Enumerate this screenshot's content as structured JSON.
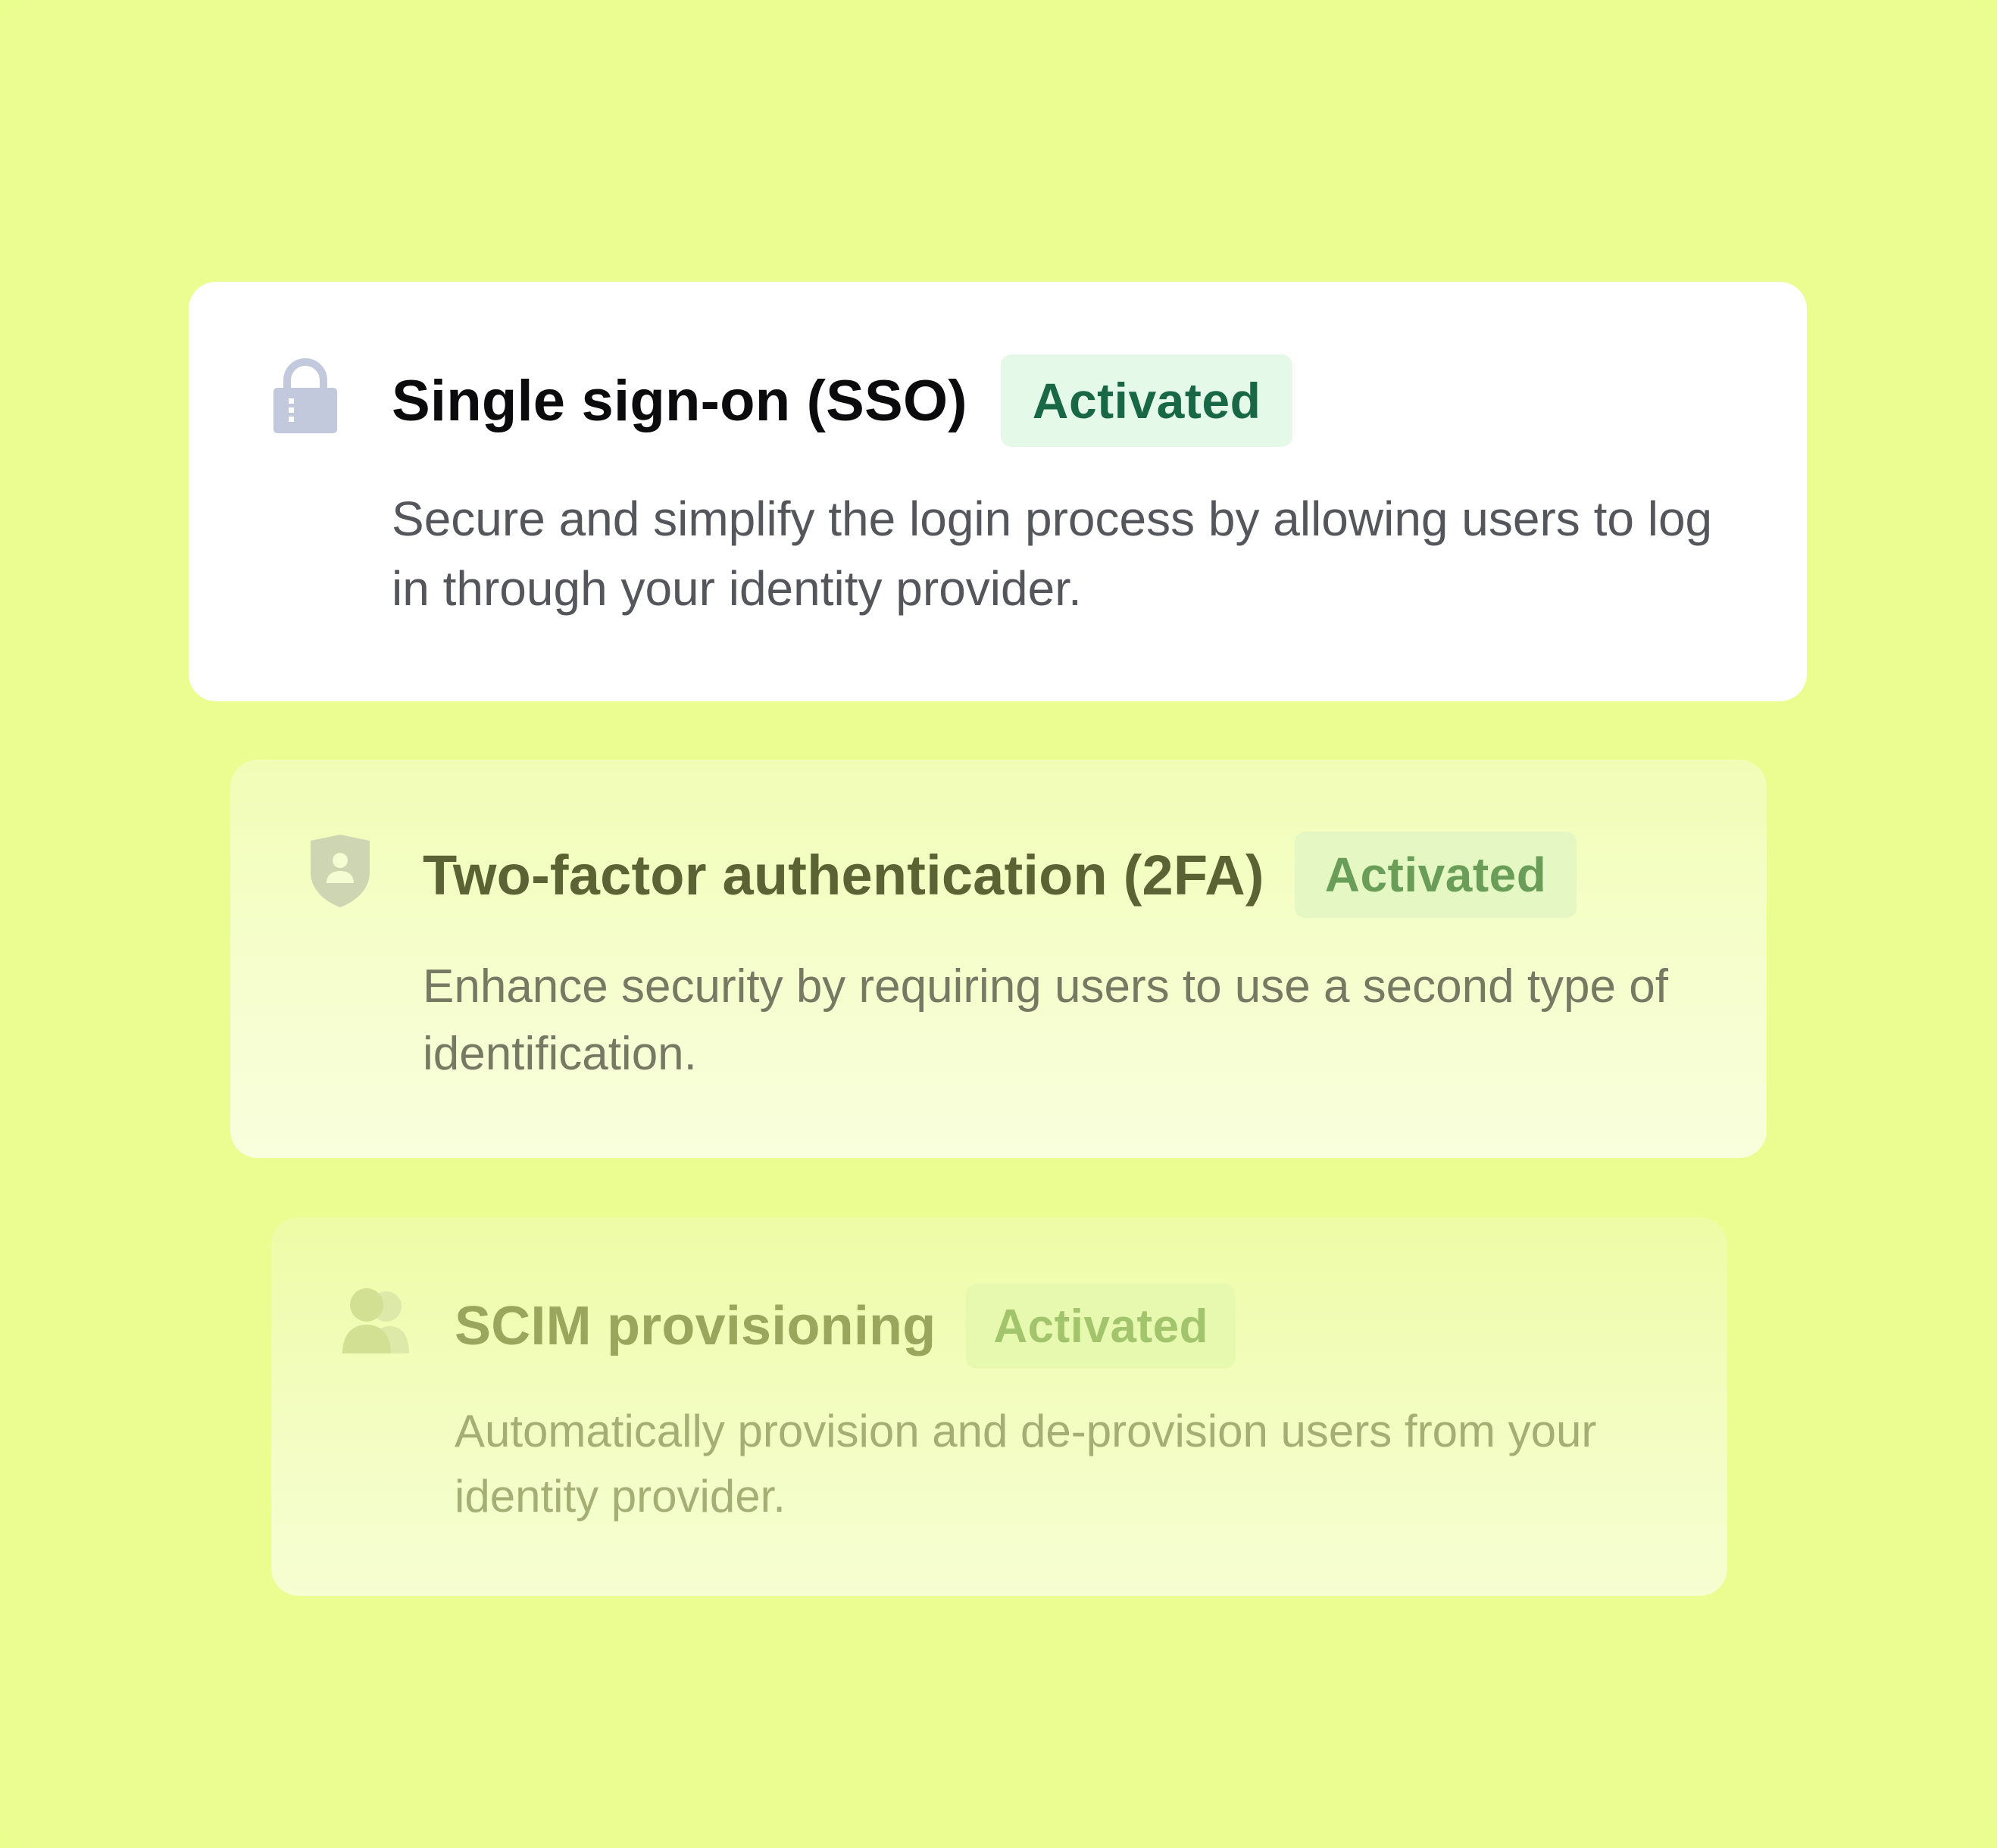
{
  "colors": {
    "background": "#ebfd90",
    "card_primary": "#ffffff",
    "badge_bg": "#e4f9e8",
    "badge_text": "#186745",
    "title_text": "#0b0b0d",
    "desc_text": "#55565b"
  },
  "features": [
    {
      "icon": "lock-icon",
      "title": "Single sign-on (SSO)",
      "status": "Activated",
      "description": "Secure and simplify the login process by allowing users to log in through your identity provider."
    },
    {
      "icon": "shield-user-icon",
      "title": "Two-factor authentication (2FA)",
      "status": "Activated",
      "description": "Enhance security by requiring users to use a second type of identification."
    },
    {
      "icon": "users-icon",
      "title": "SCIM provisioning",
      "status": "Activated",
      "description": "Automatically provision and de-provision users from your identity provider."
    }
  ]
}
